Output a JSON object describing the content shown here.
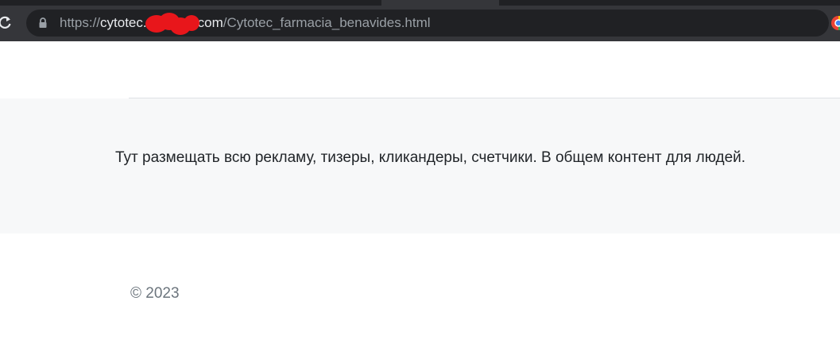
{
  "browser": {
    "url_scheme": "https://",
    "url_host_visible_start": "cytotec.",
    "url_host_visible_end": "com",
    "url_path": "/Cytotec_farmacia_benavides.html",
    "icons": {
      "reload": "reload-icon",
      "lock": "lock-icon",
      "extension": "extension-icon"
    }
  },
  "page": {
    "ad_block_text": "Тут размещать всю рекламу, тизеры, кликандеры, счетчики. В общем контент для людей.",
    "footer_copyright": "© 2023"
  },
  "colors": {
    "chrome_dark": "#202124",
    "chrome_toolbar": "#35363a",
    "redaction": "#e8161b",
    "ad_band_bg": "#f7f8f9",
    "body_text": "#212529",
    "muted_text": "#6c757d"
  }
}
